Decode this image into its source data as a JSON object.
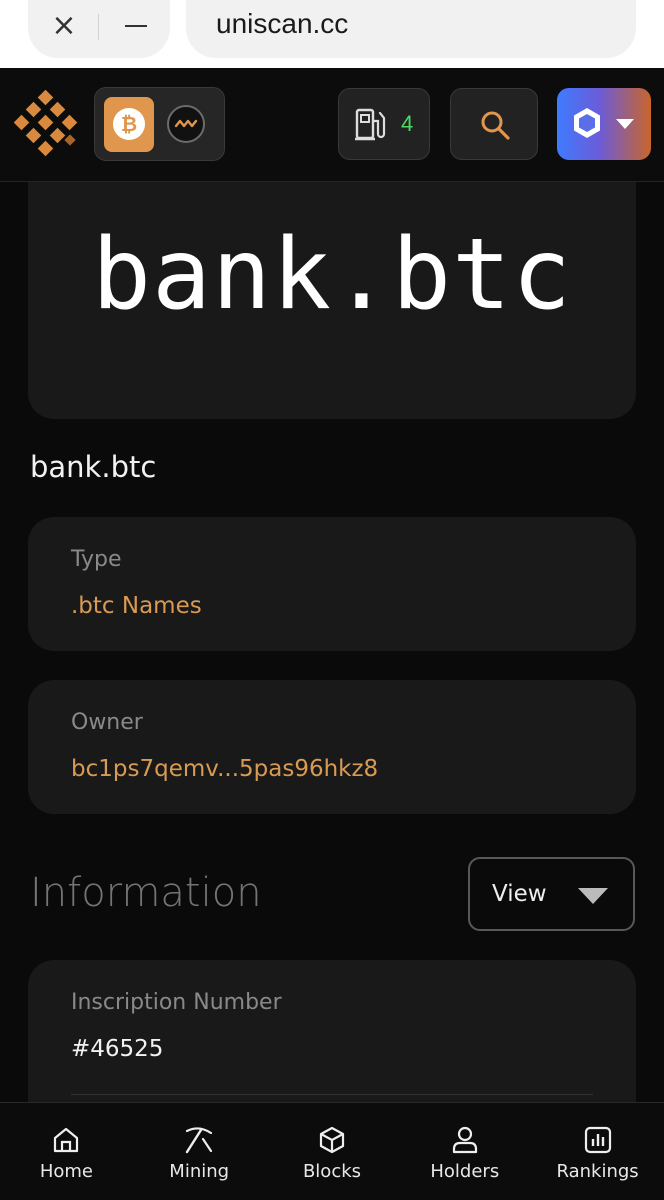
{
  "browser": {
    "url": "uniscan.cc"
  },
  "header": {
    "gas_value": "4",
    "accent": "#e0964c"
  },
  "preview": {
    "text": "bank.btc"
  },
  "inscription_name": "bank.btc",
  "type_card": {
    "label": "Type",
    "value": ".btc Names"
  },
  "owner_card": {
    "label": "Owner",
    "value": "bc1ps7qemv...5pas96hkz8"
  },
  "information": {
    "title": "Information",
    "view_label": "View"
  },
  "inscription_card": {
    "label": "Inscription Number",
    "value": "#46525"
  },
  "bottom_nav": [
    {
      "label": "Home",
      "icon": "home-icon"
    },
    {
      "label": "Mining",
      "icon": "pickaxe-icon"
    },
    {
      "label": "Blocks",
      "icon": "cube-icon"
    },
    {
      "label": "Holders",
      "icon": "user-icon"
    },
    {
      "label": "Rankings",
      "icon": "bar-chart-icon"
    }
  ]
}
